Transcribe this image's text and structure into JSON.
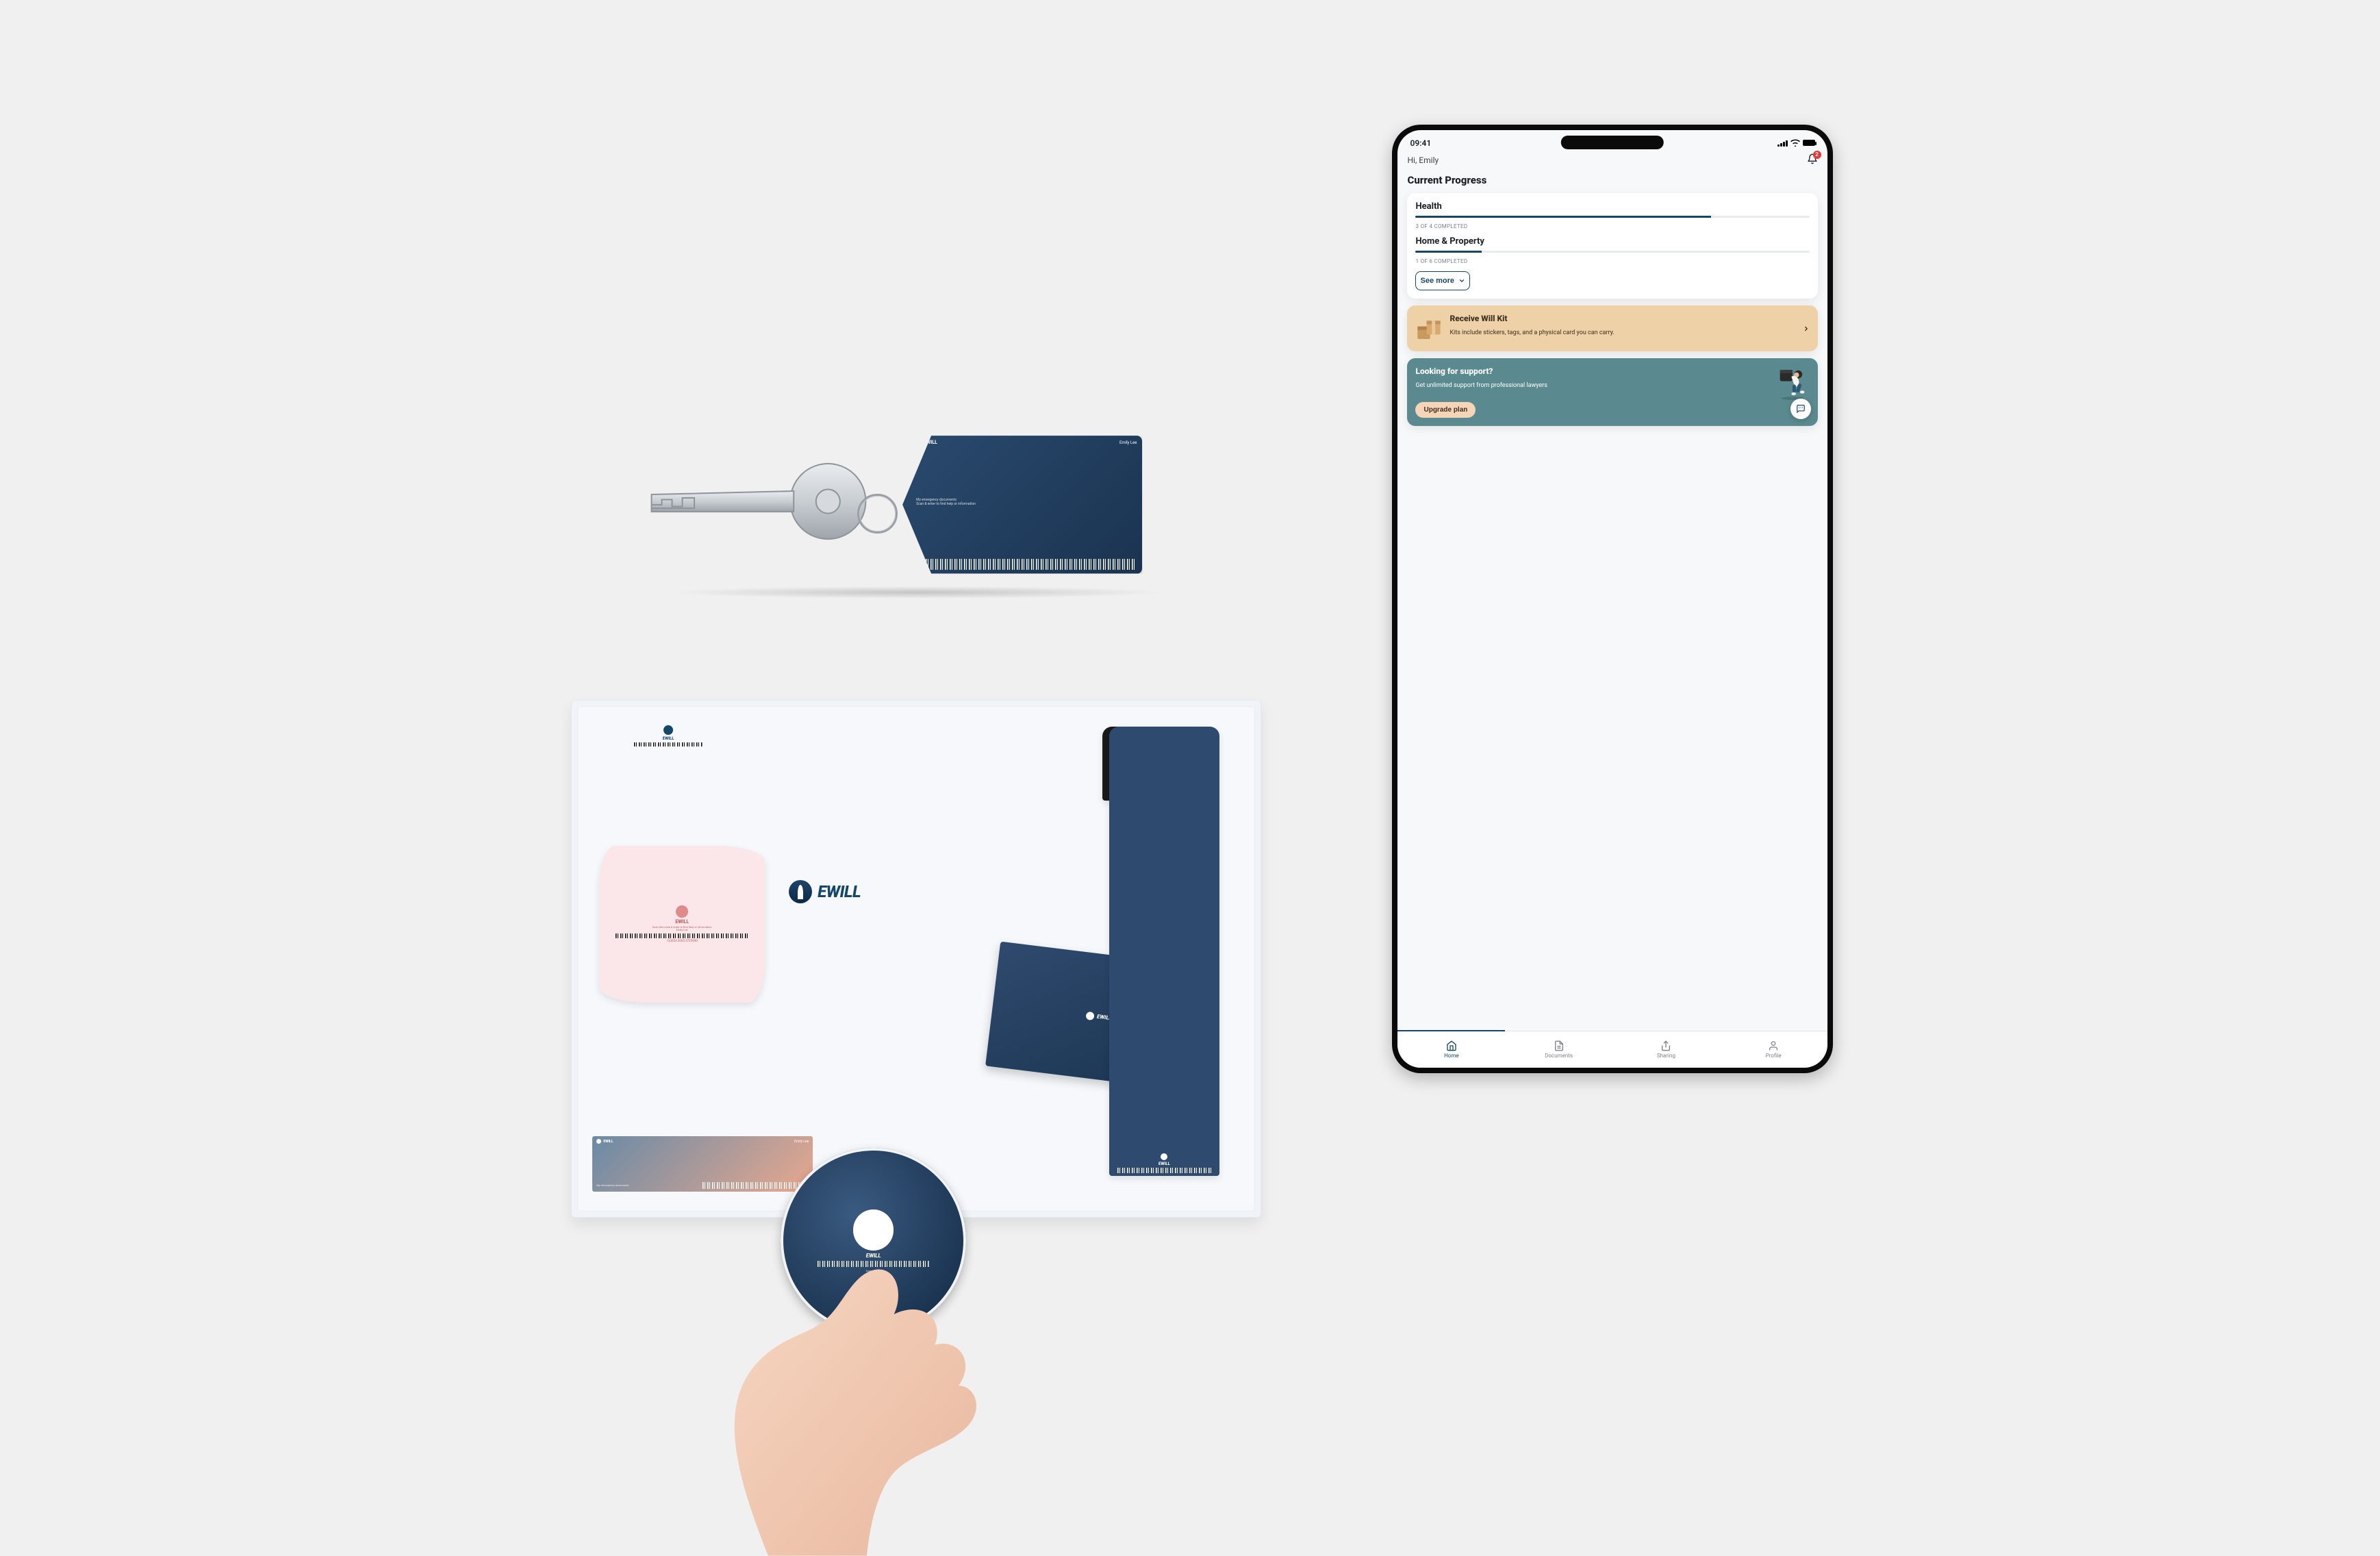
{
  "brand": {
    "name": "EWILL"
  },
  "status_bar": {
    "time": "09:41"
  },
  "header": {
    "greeting": "Hi, Emily",
    "notifications": 2
  },
  "page": {
    "title": "Current Progress"
  },
  "progress": {
    "items": [
      {
        "title": "Health",
        "completed": 3,
        "total": 4,
        "subtext": "3 OF 4 COMPLETED",
        "pct": 75
      },
      {
        "title": "Home & Property",
        "completed": 1,
        "total": 6,
        "subtext": "1 OF 6 COMPLETED",
        "pct": 16.7
      }
    ],
    "see_more": "See more"
  },
  "promos": {
    "kit": {
      "title": "Receive Will Kit",
      "body": "Kits include stickers, tags, and a physical card you can carry."
    },
    "support": {
      "title": "Looking for support?",
      "body": "Get unlimited support from professional lawyers",
      "cta": "Upgrade plan"
    }
  },
  "tabs": [
    {
      "key": "home",
      "label": "Home",
      "active": true
    },
    {
      "key": "documents",
      "label": "Documents",
      "active": false
    },
    {
      "key": "sharing",
      "label": "Sharing",
      "active": false
    },
    {
      "key": "profile",
      "label": "Profile",
      "active": false
    }
  ],
  "keytag": {
    "owner": "Emily Lee",
    "line1": "My emergency documents",
    "line2": "Scan & enter to find help or information"
  },
  "stickers": {
    "pink": {
      "code": "123654 0095 3725690",
      "owner": "Emily Lee"
    },
    "grad": {
      "owner": "Emily Lee"
    }
  }
}
